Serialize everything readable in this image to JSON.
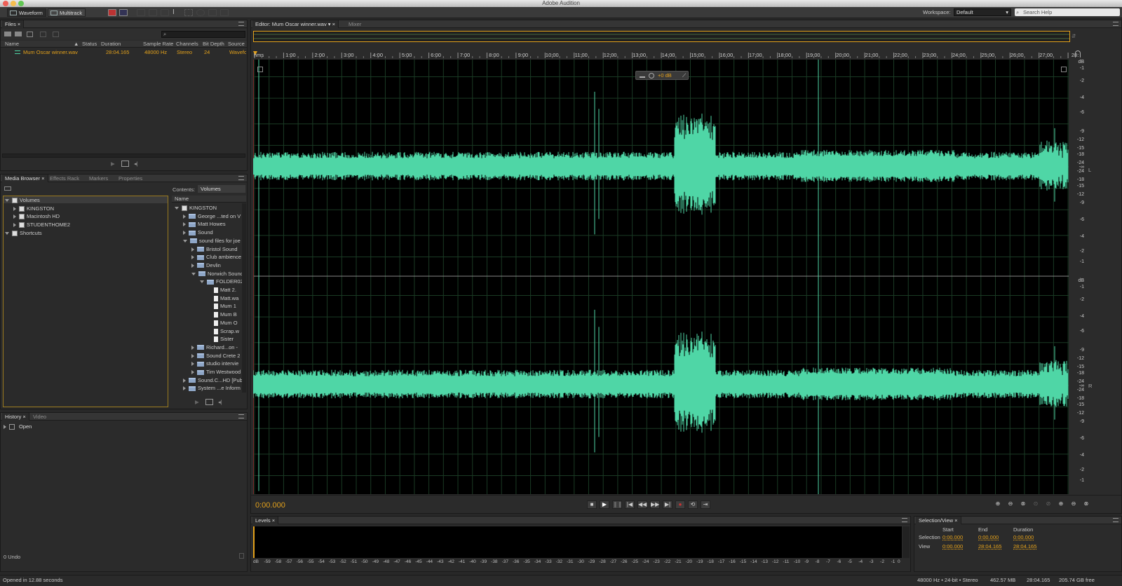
{
  "app_title": "Adobe Audition",
  "toolbar": {
    "waveform_label": "Waveform",
    "multitrack_label": "Multitrack",
    "workspace_label": "Workspace:",
    "workspace_value": "Default",
    "search_placeholder": "Search Help"
  },
  "files_panel": {
    "tab": "Files",
    "columns": [
      "Name",
      "Status",
      "Duration",
      "Sample Rate",
      "Channels",
      "Bit Depth",
      "Source"
    ],
    "rows": [
      {
        "name": "Mum Oscar winner.wav",
        "status": "",
        "duration": "28:04.165",
        "sample_rate": "48000 Hz",
        "channels": "Stereo",
        "bit_depth": "24",
        "source": "Wavefo"
      }
    ]
  },
  "media_browser": {
    "tabs": [
      "Media Browser",
      "Effects Rack",
      "Markers",
      "Properties"
    ],
    "left_tree": [
      {
        "label": "Volumes",
        "indent": 0,
        "expanded": true,
        "icon": "drive"
      },
      {
        "label": "KINGSTON",
        "indent": 1,
        "expanded": false,
        "icon": "drive"
      },
      {
        "label": "Macintosh HD",
        "indent": 1,
        "expanded": false,
        "icon": "drive"
      },
      {
        "label": "STUDENTHOME2",
        "indent": 1,
        "expanded": false,
        "icon": "drive"
      },
      {
        "label": "Shortcuts",
        "indent": 0,
        "expanded": true,
        "icon": "shortcut"
      }
    ],
    "contents_label": "Contents:",
    "contents_value": "Volumes",
    "name_header": "Name",
    "right_tree": [
      {
        "label": "KINGSTON",
        "indent": 0,
        "expanded": true,
        "icon": "drive"
      },
      {
        "label": "George ...ted on V",
        "indent": 1,
        "expanded": false,
        "icon": "folder"
      },
      {
        "label": "Matt Howes",
        "indent": 1,
        "expanded": false,
        "icon": "folder"
      },
      {
        "label": "Sound",
        "indent": 1,
        "expanded": false,
        "icon": "folder"
      },
      {
        "label": "sound files for joe",
        "indent": 1,
        "expanded": true,
        "icon": "folder"
      },
      {
        "label": "Bristol Sound",
        "indent": 2,
        "expanded": false,
        "icon": "folder"
      },
      {
        "label": "Club ambience",
        "indent": 2,
        "expanded": false,
        "icon": "folder"
      },
      {
        "label": "Devlin",
        "indent": 2,
        "expanded": false,
        "icon": "folder"
      },
      {
        "label": "Norwich Sound",
        "indent": 2,
        "expanded": true,
        "icon": "folder"
      },
      {
        "label": "FOLDER02",
        "indent": 3,
        "expanded": true,
        "icon": "folder"
      },
      {
        "label": "Matt 2.",
        "indent": 4,
        "expanded": null,
        "icon": "file"
      },
      {
        "label": "Matt.wa",
        "indent": 4,
        "expanded": null,
        "icon": "file"
      },
      {
        "label": "Mum 1",
        "indent": 4,
        "expanded": null,
        "icon": "file"
      },
      {
        "label": "Mum B",
        "indent": 4,
        "expanded": null,
        "icon": "file"
      },
      {
        "label": "Mum O",
        "indent": 4,
        "expanded": null,
        "icon": "file"
      },
      {
        "label": "Scrap.w",
        "indent": 4,
        "expanded": null,
        "icon": "file"
      },
      {
        "label": "Sister",
        "indent": 4,
        "expanded": null,
        "icon": "file"
      },
      {
        "label": "Richard...on -",
        "indent": 2,
        "expanded": false,
        "icon": "folder"
      },
      {
        "label": "Sound Crete 2",
        "indent": 2,
        "expanded": false,
        "icon": "folder"
      },
      {
        "label": "studio intervie",
        "indent": 2,
        "expanded": false,
        "icon": "folder"
      },
      {
        "label": "Tim Westwood",
        "indent": 2,
        "expanded": false,
        "icon": "folder"
      },
      {
        "label": "Sound.C...HD [Pub",
        "indent": 1,
        "expanded": false,
        "icon": "folder"
      },
      {
        "label": "System ...e Inform",
        "indent": 1,
        "expanded": false,
        "icon": "folder"
      }
    ]
  },
  "history_panel": {
    "tabs": [
      "History",
      "Video"
    ],
    "items": [
      "Open"
    ],
    "undo_count": "0 Undo"
  },
  "editor": {
    "tab": "Editor: Mum Oscar winner.wav",
    "mixer_tab": "Mixer",
    "hud_gain": "+0 dB",
    "time_ticks": [
      "hms",
      "1:00",
      "2:00",
      "3:00",
      "4:00",
      "5:00",
      "6:00",
      "7:00",
      "8:00",
      "9:00",
      "10:00",
      "11:00",
      "12:00",
      "13:00",
      "14:00",
      "15:00",
      "16:00",
      "17:00",
      "18:00",
      "19:00",
      "20:00",
      "21:00",
      "22:00",
      "23:00",
      "24:00",
      "25:00",
      "26:00",
      "27:00",
      "28:"
    ],
    "db_scale": [
      "dB",
      "-1",
      "-2",
      "-4",
      "-6",
      "-9",
      "-12",
      "-15",
      "-18",
      "-24",
      "-∞",
      "-24",
      "-18",
      "-15",
      "-12",
      "-9",
      "-6",
      "-4",
      "-2",
      "-1"
    ],
    "channel_left": "L",
    "channel_right": "R",
    "current_time": "0:00.000"
  },
  "levels_panel": {
    "tab": "Levels",
    "scale": [
      "dB",
      "-59",
      "-58",
      "-57",
      "-56",
      "-55",
      "-54",
      "-53",
      "-52",
      "-51",
      "-50",
      "-49",
      "-48",
      "-47",
      "-46",
      "-45",
      "-44",
      "-43",
      "-42",
      "-41",
      "-40",
      "-39",
      "-38",
      "-37",
      "-36",
      "-35",
      "-34",
      "-33",
      "-32",
      "-31",
      "-30",
      "-29",
      "-28",
      "-27",
      "-26",
      "-25",
      "-24",
      "-23",
      "-22",
      "-21",
      "-20",
      "-19",
      "-18",
      "-17",
      "-16",
      "-15",
      "-14",
      "-13",
      "-12",
      "-11",
      "-10",
      "-9",
      "-8",
      "-7",
      "-6",
      "-5",
      "-4",
      "-3",
      "-2",
      "-1",
      "0"
    ]
  },
  "selection_view": {
    "tab": "Selection/View",
    "headers": [
      "Start",
      "End",
      "Duration"
    ],
    "rows": [
      {
        "label": "Selection",
        "start": "0:00.000",
        "end": "0:00.000",
        "duration": "0:00.000"
      },
      {
        "label": "View",
        "start": "0:00.000",
        "end": "28:04.165",
        "duration": "28:04.165"
      }
    ]
  },
  "status": {
    "left": "Opened in 12.88 seconds",
    "format": "48000 Hz • 24-bit • Stereo",
    "size": "462.57 MB",
    "duration": "28:04.165",
    "free": "205.74 GB free"
  },
  "colors": {
    "waveform": "#4fd6a6",
    "accent": "#e3a11b",
    "background": "#000000",
    "grid": "#1a3a24"
  }
}
